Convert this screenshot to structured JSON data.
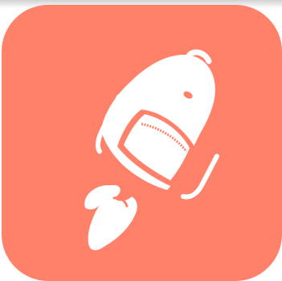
{
  "app_icon": {
    "background_color": "#FF8169",
    "glyph_color": "#FFFFFF",
    "glyph_icon": "rocket-backpack-icon"
  }
}
